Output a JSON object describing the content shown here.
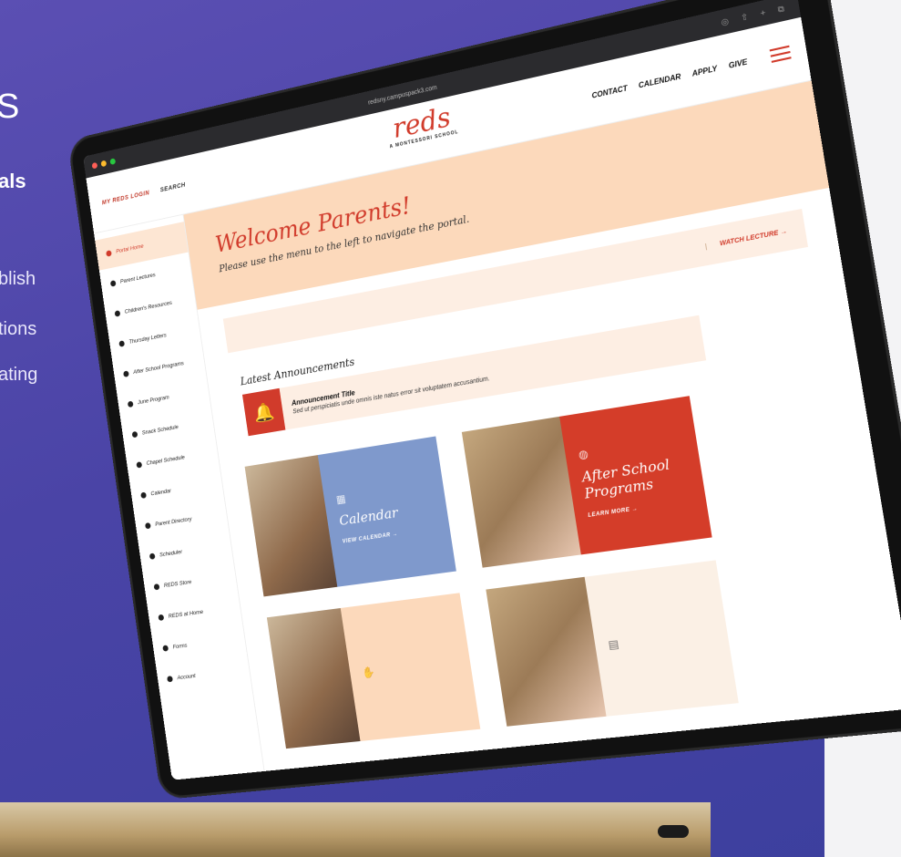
{
  "background": {
    "fragment_top": "S",
    "fragment_bold": "als",
    "fragment_lines": [
      "blish",
      "tions",
      "ating"
    ]
  },
  "browser": {
    "url": "redsny.campuspack3.com"
  },
  "header": {
    "login_label": "MY REDS LOGIN",
    "search_label": "SEARCH",
    "logo_text": "reds",
    "logo_subtitle": "A MONTESSORI SCHOOL",
    "nav": [
      "CONTACT",
      "CALENDAR",
      "APPLY",
      "GIVE"
    ]
  },
  "sidebar": {
    "items": [
      {
        "label": "Portal Home",
        "active": true
      },
      {
        "label": "Parent Lectures",
        "active": false
      },
      {
        "label": "Children's Resources",
        "active": false
      },
      {
        "label": "Thursday Letters",
        "active": false
      },
      {
        "label": "After School Programs",
        "active": false
      },
      {
        "label": "June Program",
        "active": false
      },
      {
        "label": "Snack Schedule",
        "active": false
      },
      {
        "label": "Chapel Schedule",
        "active": false
      },
      {
        "label": "Calendar",
        "active": false
      },
      {
        "label": "Parent Directory",
        "active": false
      },
      {
        "label": "Scheduler",
        "active": false
      },
      {
        "label": "REDS Store",
        "active": false
      },
      {
        "label": "REDS at Home",
        "active": false
      },
      {
        "label": "Forms",
        "active": false
      },
      {
        "label": "Account",
        "active": false
      }
    ]
  },
  "hero": {
    "title": "Welcome Parents!",
    "subtitle": "Please use the menu to the left to navigate the portal."
  },
  "lecture": {
    "link_label": "WATCH LECTURE →"
  },
  "announcements": {
    "section_title": "Latest Announcements",
    "items": [
      {
        "title": "Announcement Title",
        "body": "Sed ut perspiciatis unde omnis iste natus error sit voluptatem accusantium."
      }
    ]
  },
  "cards": [
    {
      "title": "Calendar",
      "link": "VIEW CALENDAR →",
      "icon": "calendar-icon"
    },
    {
      "title": "After School Programs",
      "link": "LEARN MORE →",
      "icon": "palette-icon"
    },
    {
      "title": "",
      "link": "",
      "icon": "hand-icon"
    },
    {
      "title": "",
      "link": "",
      "icon": "document-icon"
    }
  ],
  "colors": {
    "accent": "#d13b2b",
    "peach": "#fcd9bb",
    "blue_card": "#7f99cc",
    "red_card": "#d43d29"
  }
}
